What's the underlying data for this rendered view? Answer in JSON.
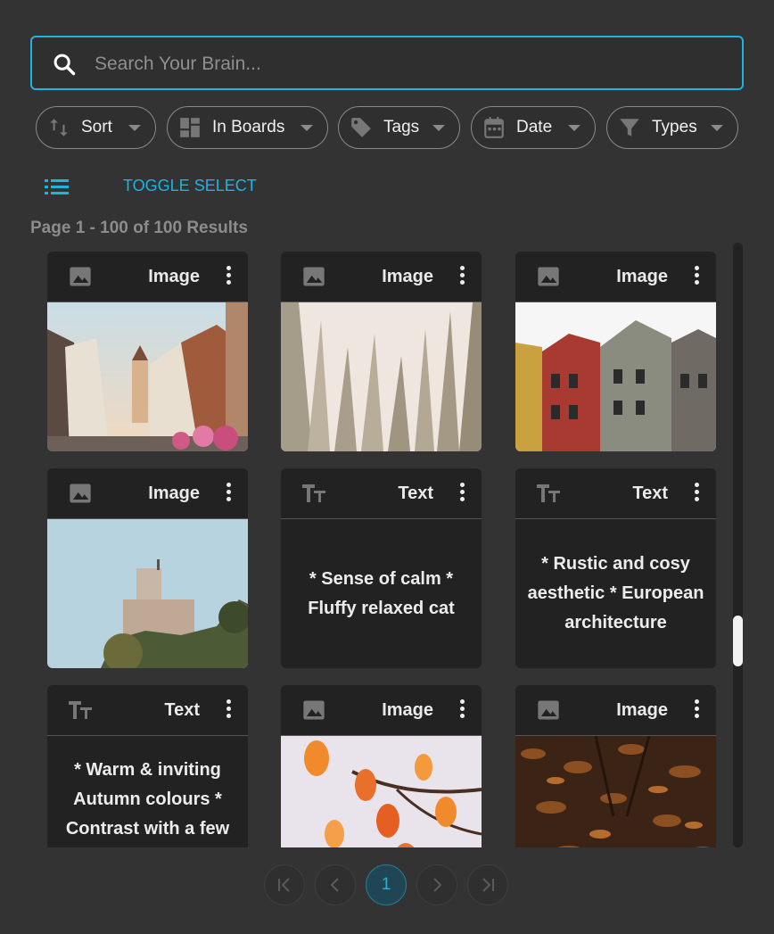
{
  "search": {
    "placeholder": "Search Your Brain..."
  },
  "filters": [
    {
      "label": "Sort",
      "icon": "sort-icon"
    },
    {
      "label": "In Boards",
      "icon": "boards-icon"
    },
    {
      "label": "Tags",
      "icon": "tag-icon"
    },
    {
      "label": "Date",
      "icon": "calendar-icon"
    },
    {
      "label": "Types",
      "icon": "filter-icon"
    }
  ],
  "toolbar": {
    "toggle_label": "TOGGLE SELECT"
  },
  "results": {
    "summary": "Page 1 - 100 of 100 Results"
  },
  "cards": [
    {
      "type": "Image"
    },
    {
      "type": "Image"
    },
    {
      "type": "Image"
    },
    {
      "type": "Image"
    },
    {
      "type": "Text",
      "text": "* Sense of calm * Fluffy relaxed cat"
    },
    {
      "type": "Text",
      "text": "* Rustic and cosy aesthetic * European architecture"
    },
    {
      "type": "Text",
      "text": "* Warm & inviting Autumn colours * Contrast with a few"
    },
    {
      "type": "Image"
    },
    {
      "type": "Image"
    }
  ],
  "pagination": {
    "current_page": "1"
  },
  "colors": {
    "accent": "#1fb3e0",
    "background": "#333333",
    "card": "#222222"
  }
}
